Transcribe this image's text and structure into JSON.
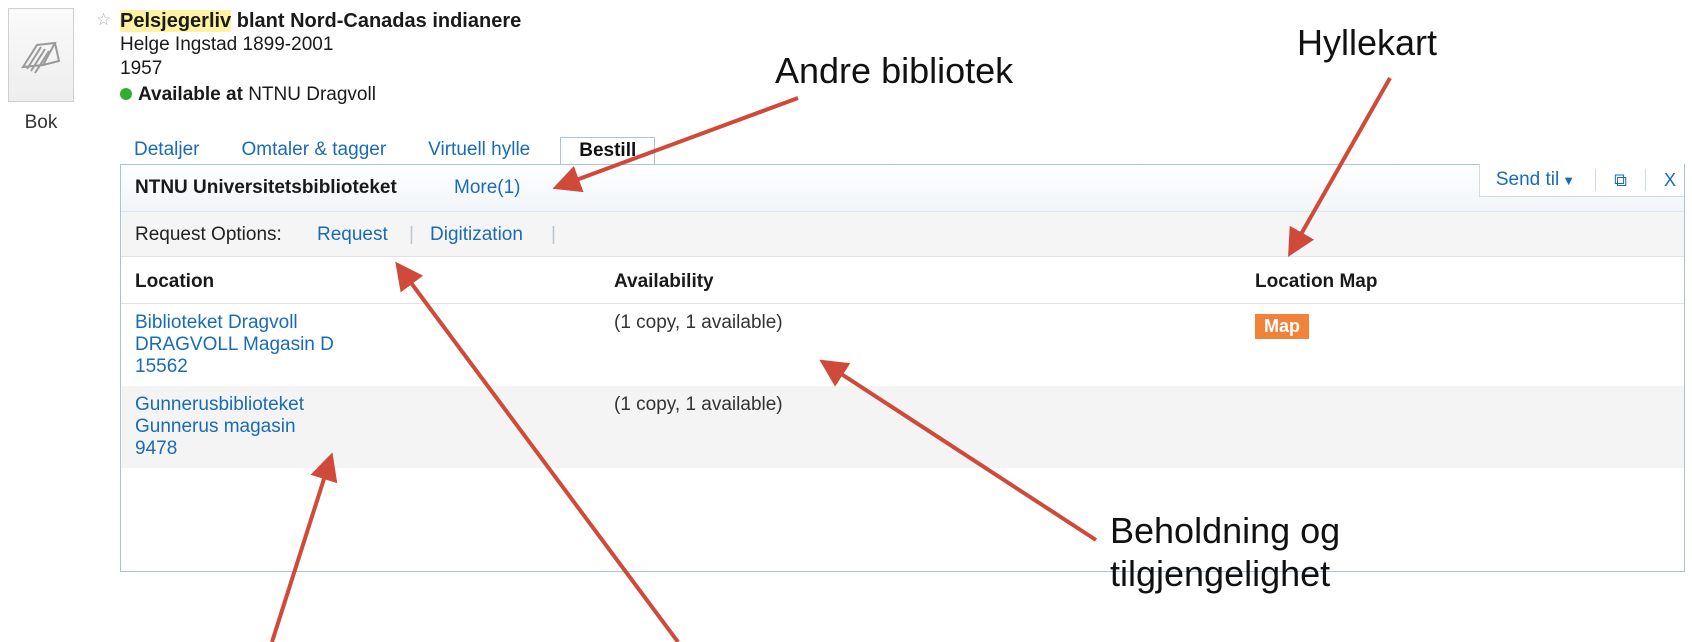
{
  "record": {
    "type_label": "Bok",
    "title_highlight": "Pelsjegerliv",
    "title_rest": " blant Nord-Canadas indianere",
    "author": "Helge Ingstad 1899-2001",
    "year": "1957",
    "availability_status": "Available at",
    "availability_location": "NTNU Dragvoll"
  },
  "tabs": [
    {
      "label": "Detaljer"
    },
    {
      "label": "Omtaler & tagger"
    },
    {
      "label": "Virtuell hylle"
    },
    {
      "label": "Bestill",
      "active": true
    }
  ],
  "panel": {
    "library_name": "NTNU Universitetsbiblioteket",
    "more_link": "More(1)",
    "send_label": "Send til",
    "close_label": "X",
    "request_label": "Request Options:",
    "request_options": [
      "Request",
      "Digitization"
    ],
    "separator": "|",
    "columns": {
      "location": "Location",
      "availability": "Availability",
      "location_map": "Location Map"
    },
    "holdings": [
      {
        "library": "Biblioteket Dragvoll",
        "collection": "DRAGVOLL Magasin D",
        "callnumber": "15562",
        "availability": "(1 copy, 1 available)",
        "map_label": "Map"
      },
      {
        "library": "Gunnerusbiblioteket",
        "collection": "Gunnerus magasin",
        "callnumber": "9478",
        "availability": "(1 copy, 1 available)"
      }
    ]
  },
  "annotations": {
    "andre_bibliotek": "Andre bibliotek",
    "hyllekart": "Hyllekart",
    "beholdning_line1": "Beholdning og",
    "beholdning_line2": "tilgjengelighet",
    "arrow_color": "#d04a3a"
  },
  "colors": {
    "link": "#1a6bb5",
    "map_button": "#f0823a",
    "available_dot": "#2fae2f",
    "highlight": "#fff3a3"
  }
}
